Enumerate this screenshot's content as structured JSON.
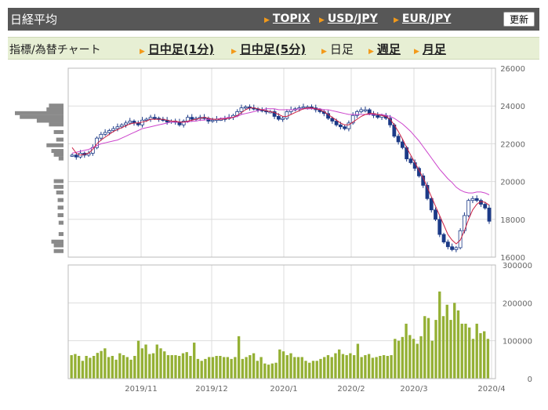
{
  "header": {
    "title": "日経平均",
    "links": [
      "TOPIX",
      "USD/JPY",
      "EUR/JPY"
    ],
    "refresh_label": "更新"
  },
  "toolbar": {
    "label": "指標/為替チャート",
    "items": [
      {
        "label": "日中足(1分)",
        "active": false
      },
      {
        "label": "日中足(5分)",
        "active": false
      },
      {
        "label": "日足",
        "active": true
      },
      {
        "label": "週足",
        "active": false
      },
      {
        "label": "月足",
        "active": false
      }
    ]
  },
  "colors": {
    "accent_triangle": "#f39a1a",
    "candle": "#1c3a87",
    "ma_short": "#cc2244",
    "ma_long": "#cc44cc",
    "volume_bar": "#94b034",
    "volume_profile": "#8a8a8a"
  },
  "chart_data": [
    {
      "type": "candlestick",
      "title": "",
      "y_ticks": [
        16000,
        18000,
        20000,
        22000,
        24000,
        26000
      ],
      "y_tick_labels": [
        "16000",
        "18000",
        "20000",
        "22000",
        "24000",
        "26000"
      ],
      "ylim": [
        16000,
        26000
      ],
      "x_tick_labels": [
        "2019/11",
        "2019/12",
        "2020/1",
        "2020/2",
        "2020/3",
        "2020/4"
      ],
      "grid": true,
      "close_values_approx": [
        21400,
        21300,
        21500,
        21400,
        21500,
        21800,
        22300,
        22500,
        22600,
        22700,
        22800,
        22900,
        23000,
        23100,
        23200,
        23100,
        23000,
        23250,
        23300,
        23400,
        23350,
        23300,
        23250,
        23150,
        23200,
        23150,
        23000,
        23200,
        23400,
        23300,
        23350,
        23400,
        23350,
        23200,
        23250,
        23300,
        23300,
        23350,
        23400,
        23500,
        23700,
        23900,
        23950,
        23900,
        23850,
        23800,
        23750,
        23700,
        23700,
        23450,
        23300,
        23350,
        23700,
        23800,
        23850,
        23900,
        23950,
        23950,
        23900,
        23800,
        23700,
        23600,
        23350,
        23200,
        23000,
        22900,
        22800,
        23100,
        23500,
        23700,
        23800,
        23800,
        23600,
        23500,
        23400,
        23500,
        23350,
        23000,
        22400,
        22100,
        21800,
        21200,
        21000,
        20700,
        20300,
        19800,
        19100,
        18500,
        18000,
        17200,
        16800,
        16550,
        16400,
        16500,
        17400,
        18200,
        19000,
        19100,
        19000,
        18800,
        18600,
        17900
      ],
      "ma_short_approx": [
        21800,
        21500,
        21400,
        21450,
        21500,
        21700,
        22000,
        22200,
        22350,
        22500,
        22650,
        22750,
        22850,
        22950,
        23050,
        23100,
        23100,
        23150,
        23200,
        23300,
        23300,
        23300,
        23300,
        23250,
        23200,
        23200,
        23150,
        23150,
        23200,
        23250,
        23300,
        23350,
        23400,
        23350,
        23300,
        23300,
        23300,
        23320,
        23350,
        23400,
        23500,
        23650,
        23800,
        23900,
        23900,
        23850,
        23800,
        23750,
        23700,
        23650,
        23550,
        23450,
        23450,
        23550,
        23650,
        23750,
        23850,
        23900,
        23900,
        23850,
        23800,
        23700,
        23550,
        23400,
        23250,
        23100,
        23000,
        23000,
        23150,
        23300,
        23450,
        23550,
        23600,
        23600,
        23550,
        23500,
        23450,
        23300,
        23000,
        22650,
        22250,
        21800,
        21400,
        21000,
        20600,
        20200,
        19700,
        19200,
        18700,
        18200,
        17700,
        17200,
        16900,
        16700,
        16900,
        17400,
        18000,
        18500,
        18800,
        18950,
        18900,
        18750
      ],
      "ma_long_approx": [
        21500,
        21550,
        21600,
        21650,
        21700,
        21800,
        21900,
        22000,
        22050,
        22100,
        22150,
        22200,
        22300,
        22400,
        22500,
        22600,
        22700,
        22800,
        22850,
        22900,
        22950,
        23000,
        23050,
        23100,
        23150,
        23150,
        23150,
        23150,
        23150,
        23200,
        23200,
        23250,
        23250,
        23300,
        23300,
        23300,
        23350,
        23350,
        23400,
        23400,
        23450,
        23550,
        23600,
        23650,
        23700,
        23750,
        23800,
        23850,
        23850,
        23850,
        23800,
        23800,
        23800,
        23800,
        23800,
        23850,
        23850,
        23850,
        23850,
        23850,
        23850,
        23800,
        23800,
        23750,
        23700,
        23650,
        23600,
        23550,
        23550,
        23550,
        23550,
        23550,
        23550,
        23550,
        23550,
        23550,
        23500,
        23450,
        23350,
        23200,
        23050,
        22850,
        22650,
        22400,
        22150,
        21850,
        21550,
        21250,
        20950,
        20650,
        20400,
        20150,
        19950,
        19700,
        19550,
        19450,
        19400,
        19400,
        19450,
        19450,
        19400,
        19300
      ],
      "series": [
        {
          "name": "",
          "kind": "candles"
        },
        {
          "name": "",
          "kind": "moving_average_short"
        },
        {
          "name": "",
          "kind": "moving_average_long"
        }
      ],
      "volume_profile_approx": [
        {
          "price": 24000,
          "value": 0.3
        },
        {
          "price": 23800,
          "value": 0.35
        },
        {
          "price": 23600,
          "value": 1.0
        },
        {
          "price": 23400,
          "value": 0.9
        },
        {
          "price": 23200,
          "value": 0.55
        },
        {
          "price": 23000,
          "value": 0.3
        },
        {
          "price": 22600,
          "value": 0.2
        },
        {
          "price": 22200,
          "value": 0.15
        },
        {
          "price": 21900,
          "value": 0.35
        },
        {
          "price": 21600,
          "value": 0.25
        },
        {
          "price": 21400,
          "value": 0.2
        },
        {
          "price": 21200,
          "value": 0.1
        },
        {
          "price": 20000,
          "value": 0.2
        },
        {
          "price": 19700,
          "value": 0.2
        },
        {
          "price": 19400,
          "value": 0.15
        },
        {
          "price": 19000,
          "value": 0.12
        },
        {
          "price": 18600,
          "value": 0.12
        },
        {
          "price": 18200,
          "value": 0.12
        },
        {
          "price": 17800,
          "value": 0.1
        },
        {
          "price": 17200,
          "value": 0.1
        },
        {
          "price": 16800,
          "value": 0.25
        },
        {
          "price": 16600,
          "value": 0.2
        },
        {
          "price": 16300,
          "value": 0.2
        }
      ]
    },
    {
      "type": "bar",
      "title": "",
      "y_ticks": [
        0,
        100000,
        200000,
        300000
      ],
      "y_tick_labels": [
        "0",
        "100000",
        "200000",
        "300000"
      ],
      "ylim": [
        0,
        300000
      ],
      "values_approx": [
        62000,
        65000,
        60000,
        47000,
        60000,
        55000,
        60000,
        68000,
        73000,
        80000,
        57000,
        60000,
        50000,
        67000,
        62000,
        57000,
        50000,
        60000,
        100000,
        80000,
        90000,
        65000,
        67000,
        90000,
        80000,
        72000,
        62000,
        62000,
        62000,
        60000,
        67000,
        70000,
        60000,
        95000,
        52000,
        47000,
        52000,
        57000,
        57000,
        60000,
        60000,
        57000,
        57000,
        52000,
        57000,
        112000,
        52000,
        57000,
        62000,
        67000,
        47000,
        57000,
        40000,
        37000,
        40000,
        42000,
        77000,
        72000,
        62000,
        67000,
        57000,
        57000,
        57000,
        47000,
        42000,
        47000,
        47000,
        52000,
        57000,
        62000,
        57000,
        67000,
        77000,
        65000,
        62000,
        67000,
        62000,
        92000,
        57000,
        62000,
        65000,
        55000,
        57000,
        60000,
        62000,
        60000,
        62000,
        105000,
        100000,
        110000,
        145000,
        115000,
        105000,
        92000,
        112000,
        165000,
        160000,
        100000,
        155000,
        230000,
        165000,
        195000,
        155000,
        200000,
        180000,
        145000,
        145000,
        135000,
        105000,
        145000,
        120000,
        125000,
        105000
      ]
    }
  ]
}
